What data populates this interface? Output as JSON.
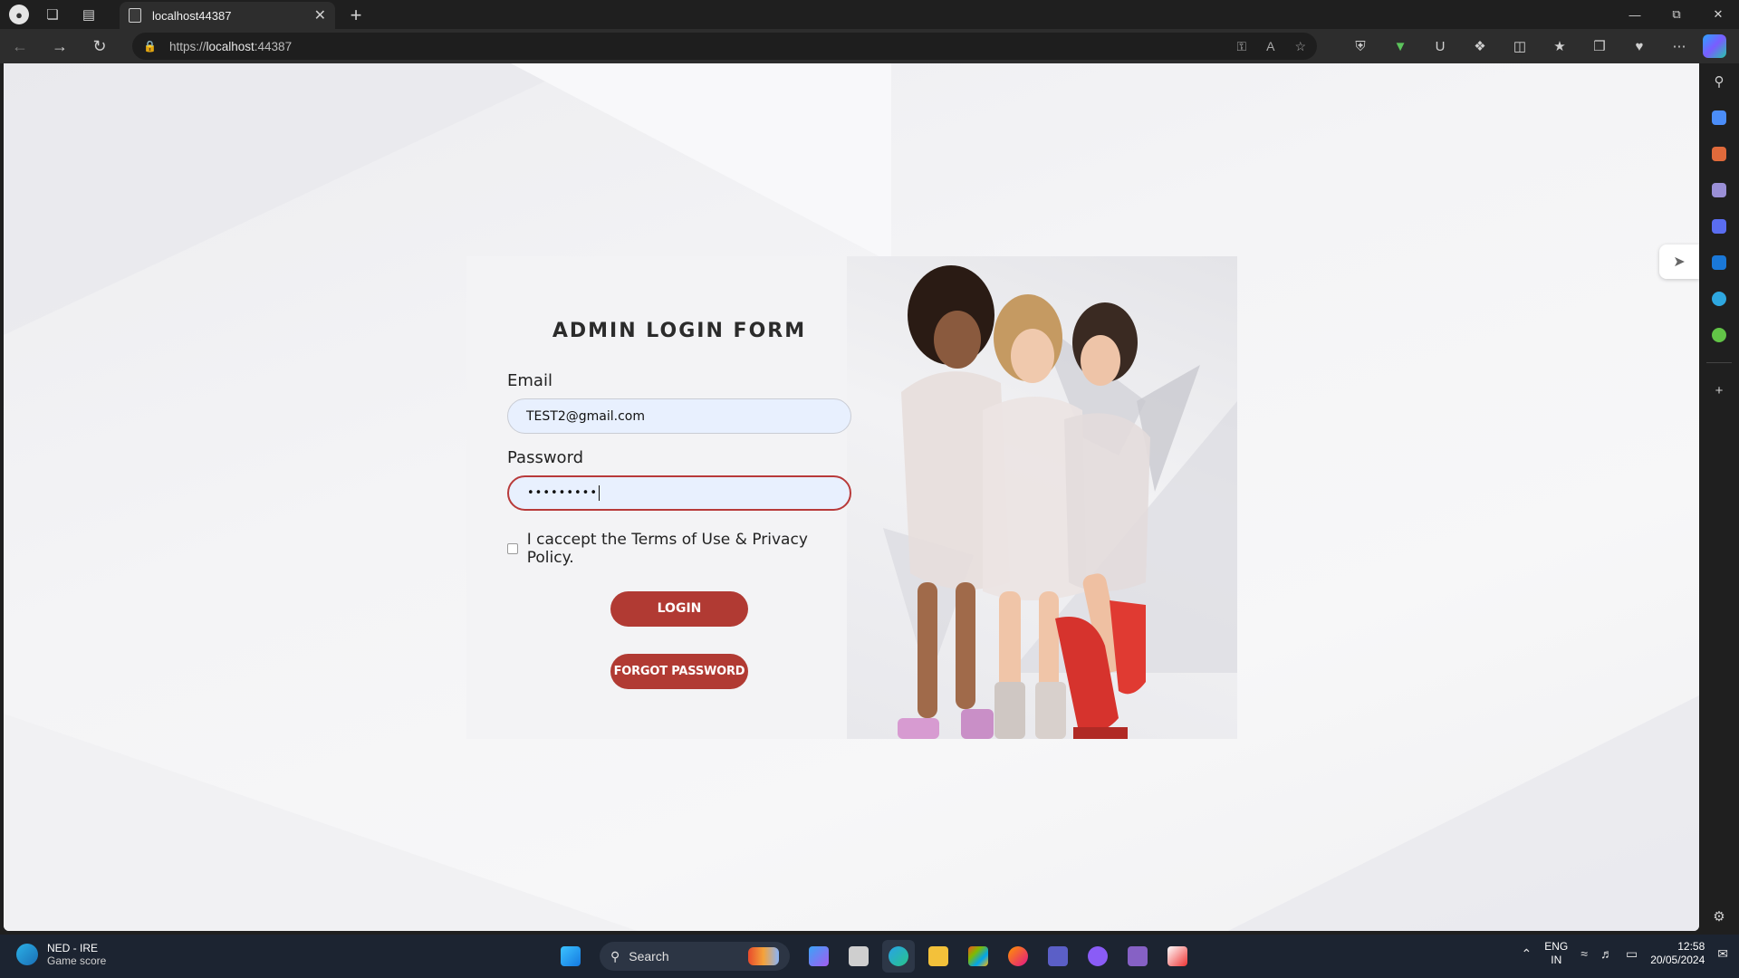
{
  "browser": {
    "tab_title": "localhost44387",
    "url_scheme": "https://",
    "url_host": "localhost",
    "url_port": ":44387"
  },
  "login_form": {
    "title": "ADMIN LOGIN FORM",
    "email_label": "Email",
    "email_value": "TEST2@gmail.com",
    "password_label": "Password",
    "password_value": "•••••••••",
    "terms_text": "I caccept the Terms of Use & Privacy Policy.",
    "terms_checked": false,
    "login_button": "LOGIN",
    "forgot_button": "FORGOT PASSWORD"
  },
  "taskbar": {
    "weather_title": "NED - IRE",
    "weather_sub": "Game score",
    "search_label": "Search",
    "lang_top": "ENG",
    "lang_bottom": "IN",
    "time": "12:58",
    "date": "20/05/2024"
  },
  "colors": {
    "accent": "#b13a33",
    "input_bg": "#e8f0fe",
    "focus_border": "#b83a3a"
  }
}
